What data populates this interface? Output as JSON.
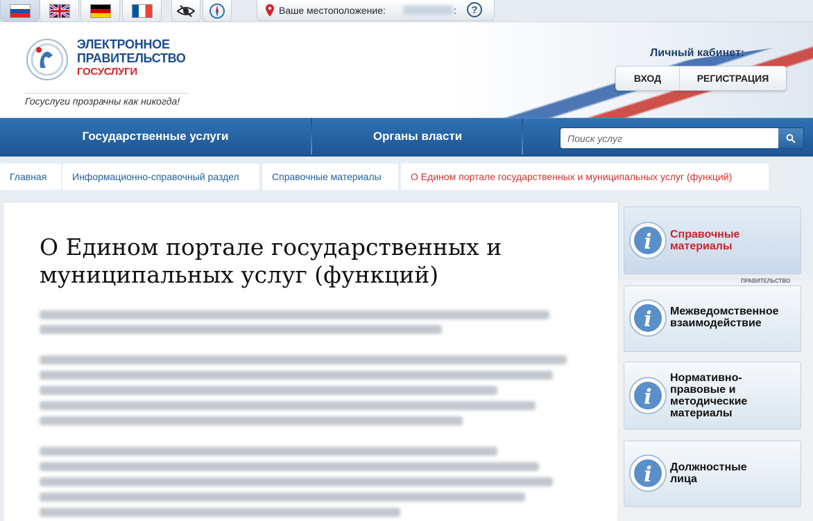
{
  "topbar": {
    "languages": [
      {
        "name": "ru-flag-icon"
      },
      {
        "name": "gb-flag-icon"
      },
      {
        "name": "de-flag-icon"
      },
      {
        "name": "fr-flag-icon"
      }
    ],
    "tools": [
      "accessibility-eye-icon",
      "compass-icon"
    ],
    "location": {
      "label": "Ваше местоположение:",
      "colon": ":",
      "help": "?"
    }
  },
  "header": {
    "logo_line1": "ЭЛЕКТРОННОЕ",
    "logo_line2": "ПРАВИТЕЛЬСТВО",
    "logo_line3": "ГОСУСЛУГИ",
    "slogan": "Госуслуги прозрачны как никогда!",
    "cabinet_title": "Личный кабинет:",
    "login_label": "ВХОД",
    "register_label": "РЕГИСТРАЦИЯ"
  },
  "nav": {
    "items": [
      "Государственные услуги",
      "Органы власти"
    ],
    "search_placeholder": "Поиск услуг"
  },
  "breadcrumbs": [
    "Главная",
    "Информационно-справочный раздел",
    "Справочные материалы",
    "О Едином портале государственных и муниципальных услуг (функций)"
  ],
  "main": {
    "title": "О Едином портале государственных и муниципальных услуг (функций)"
  },
  "sidebar": {
    "small_text": "ПРАВИТЕЛЬСТВО",
    "items": [
      {
        "label": "Справочные материалы",
        "active": true
      },
      {
        "label": "Межведомственное взаимодействие",
        "active": false
      },
      {
        "label": "Нормативно-правовые и методические материалы",
        "active": false
      },
      {
        "label": "Должностные лица",
        "active": false
      }
    ]
  },
  "colors": {
    "brand_blue": "#1d4d8c",
    "brand_red": "#d6222b",
    "nav_blue": "#1c5593",
    "crumb_current": "#d22f2f"
  }
}
